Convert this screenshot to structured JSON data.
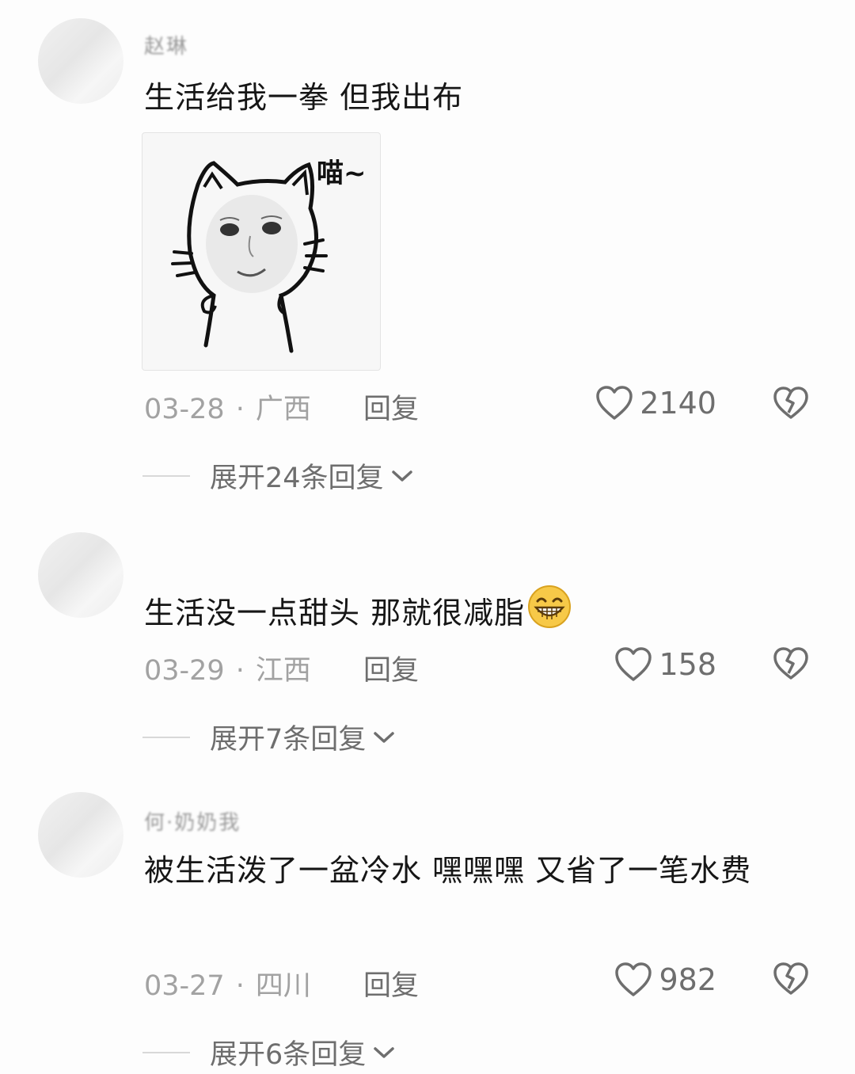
{
  "comments": [
    {
      "username": "赵琳",
      "text": "生活给我一拳 但我出布",
      "sticker_caption": "喵~",
      "date": "03-28",
      "location": "广西",
      "reply_label": "回复",
      "likes": "2140",
      "expand_label": "展开24条回复"
    },
    {
      "username": "",
      "text": "生活没一点甜头 那就很减脂",
      "emoji": "grinning-face-icon",
      "date": "03-29",
      "location": "江西",
      "reply_label": "回复",
      "likes": "158",
      "expand_label": "展开7条回复"
    },
    {
      "username": "何·奶奶我",
      "text": "被生活泼了一盆冷水 嘿嘿嘿 又省了一笔水费",
      "date": "03-27",
      "location": "四川",
      "reply_label": "回复",
      "likes": "982",
      "expand_label": "展开6条回复"
    }
  ],
  "colors": {
    "text": "#161616",
    "meta": "#a2a2a2",
    "action": "#6e6e6e",
    "background": "#fdfdfd"
  }
}
